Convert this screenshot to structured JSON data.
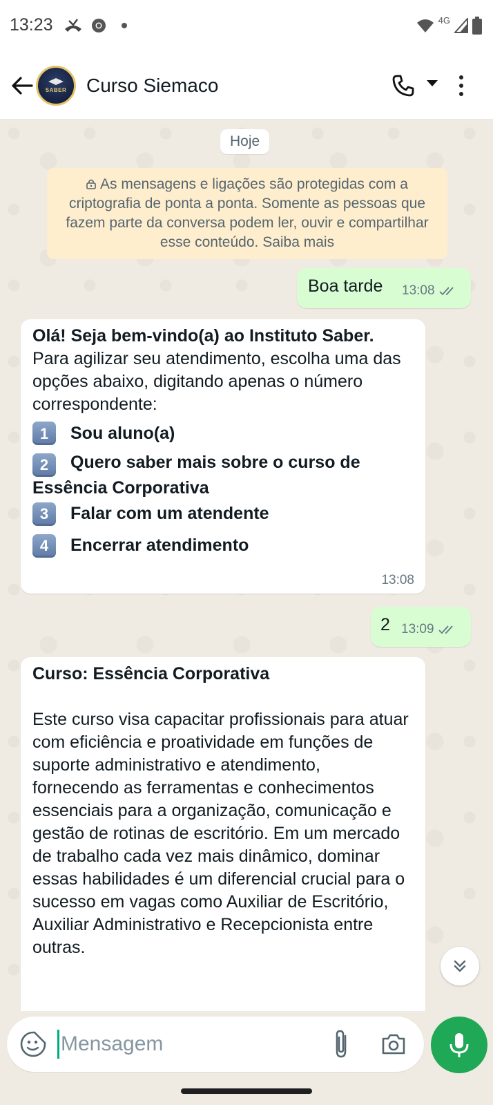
{
  "status_bar": {
    "time": "13:23",
    "network": "4G"
  },
  "header": {
    "title": "Curso Siemaco",
    "avatar_text": "SABER"
  },
  "chat": {
    "date_chip": "Hoje",
    "encryption_notice": "As mensagens e ligações são protegidas com a criptografia de ponta a ponta. Somente as pessoas que fazem parte da conversa podem ler, ouvir e compartilhar esse conteúdo. Saiba mais",
    "messages": [
      {
        "direction": "outgoing",
        "text": "Boa tarde",
        "time": "13:08",
        "status": "read"
      },
      {
        "direction": "incoming",
        "heading": "Olá! Seja bem-vindo(a) ao Instituto Saber.",
        "body": "Para agilizar seu atendimento, escolha uma das opções abaixo, digitando apenas o número correspondente:",
        "options": [
          {
            "number": "1",
            "label": "Sou aluno(a)"
          },
          {
            "number": "2",
            "label": "Quero saber mais sobre o curso de Essência Corporativa"
          },
          {
            "number": "3",
            "label": "Falar com um atendente"
          },
          {
            "number": "4",
            "label": "Encerrar atendimento"
          }
        ],
        "time": "13:08"
      },
      {
        "direction": "outgoing",
        "text": "2",
        "time": "13:09",
        "status": "read"
      },
      {
        "direction": "incoming",
        "heading": "Curso: Essência Corporativa",
        "body": "Este curso visa capacitar profissionais para atuar com eficiência e proatividade em funções de suporte administrativo e atendimento, fornecendo as ferramentas e conhecimentos essenciais para a organização, comunicação e gestão de rotinas de escritório. Em um mercado de trabalho cada vez mais dinâmico, dominar essas habilidades é um diferencial crucial para o sucesso em vagas como Auxiliar de Escritório, Auxiliar Administrativo e Recepcionista entre outras."
      }
    ]
  },
  "composer": {
    "placeholder": "Mensagem"
  },
  "colors": {
    "outgoing_bubble": "#d9fdd3",
    "incoming_bubble": "#ffffff",
    "chat_background": "#efeae2",
    "accent_green": "#1fa855",
    "notice_background": "#ffeecd"
  },
  "icons": {
    "status_bar": [
      "missed-call-icon",
      "chrome-icon",
      "notification-dot-icon",
      "wifi-icon",
      "signal-icon",
      "battery-icon"
    ],
    "header": [
      "back-arrow-icon",
      "phone-icon",
      "dropdown-caret-icon",
      "more-vert-icon"
    ],
    "chat": [
      "lock-icon",
      "double-check-icon",
      "chevron-double-down-icon"
    ],
    "composer": [
      "sticker-icon",
      "attach-icon",
      "camera-icon",
      "mic-icon"
    ]
  }
}
